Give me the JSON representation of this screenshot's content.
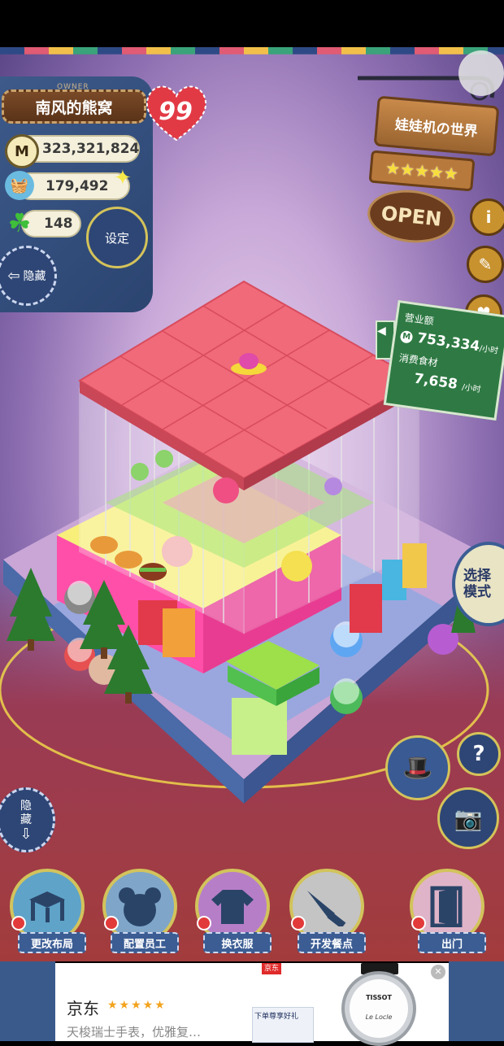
{
  "hud": {
    "owner_tag": "OWNER",
    "owner_name": "南风的熊窝",
    "level_badge": "99",
    "coins": "323,321,824",
    "coins_icon": "M",
    "food": "179,492",
    "clovers": "148",
    "settings_label": "设定",
    "hide_top_label": "隐藏",
    "hide_bottom_label": "隐\n藏"
  },
  "shop_sign": {
    "name": "娃娃机の世界",
    "stars": 5,
    "open_label": "OPEN"
  },
  "revenue_panel": {
    "revenue_label": "营业额",
    "revenue_value": "753,334",
    "revenue_unit": "/小时",
    "consumption_label": "消费食材",
    "consumption_value": "7,658",
    "consumption_unit": "/小时"
  },
  "mode_button": {
    "line1": "选择",
    "line2": "模式"
  },
  "help_label": "?",
  "bottom_menu": [
    {
      "label": "更改布局",
      "icon": "table-icon"
    },
    {
      "label": "配置员工",
      "icon": "bear-head-icon"
    },
    {
      "label": "换衣服",
      "icon": "shirt-icon"
    },
    {
      "label": "开发餐点",
      "icon": "knife-icon"
    },
    {
      "label": "出门",
      "icon": "door-icon"
    }
  ],
  "ad": {
    "brand": "京东",
    "stars": "★★★★★",
    "text": "天梭瑞士手表，优雅复…",
    "promo_banner": "下单尊享好礼",
    "watch_brand": "TISSOT",
    "watch_script": "Le Locle",
    "close_label": "✕",
    "badge": "京东"
  },
  "colors": {
    "denim": "#2e4676",
    "roof": "#f06a79",
    "floor_pink": "#ff4fa8",
    "sign_green": "#2f7a44",
    "wood": "#b8793c"
  }
}
